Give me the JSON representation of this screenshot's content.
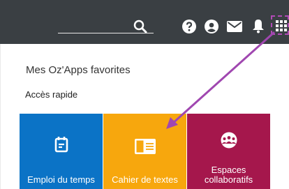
{
  "header": {
    "search": {
      "icon": "search-icon"
    },
    "icons": [
      "help-icon",
      "account-icon",
      "mail-icon",
      "bell-icon",
      "apps-grid-icon"
    ]
  },
  "panel": {
    "title": "Mes Oz'Apps favorites",
    "subtitle": "Accès rapide"
  },
  "tiles": [
    {
      "label": "Emploi du temps",
      "icon": "calendar-icon",
      "color": "#0b73c6"
    },
    {
      "label": "Cahier de textes",
      "icon": "notebook-icon",
      "color": "#f7a70d"
    },
    {
      "label_line1": "Espaces",
      "label_line2": "collaboratifs",
      "icon": "group-icon",
      "color": "#a5174c"
    }
  ],
  "annotation": {
    "color": "#a047b0"
  }
}
